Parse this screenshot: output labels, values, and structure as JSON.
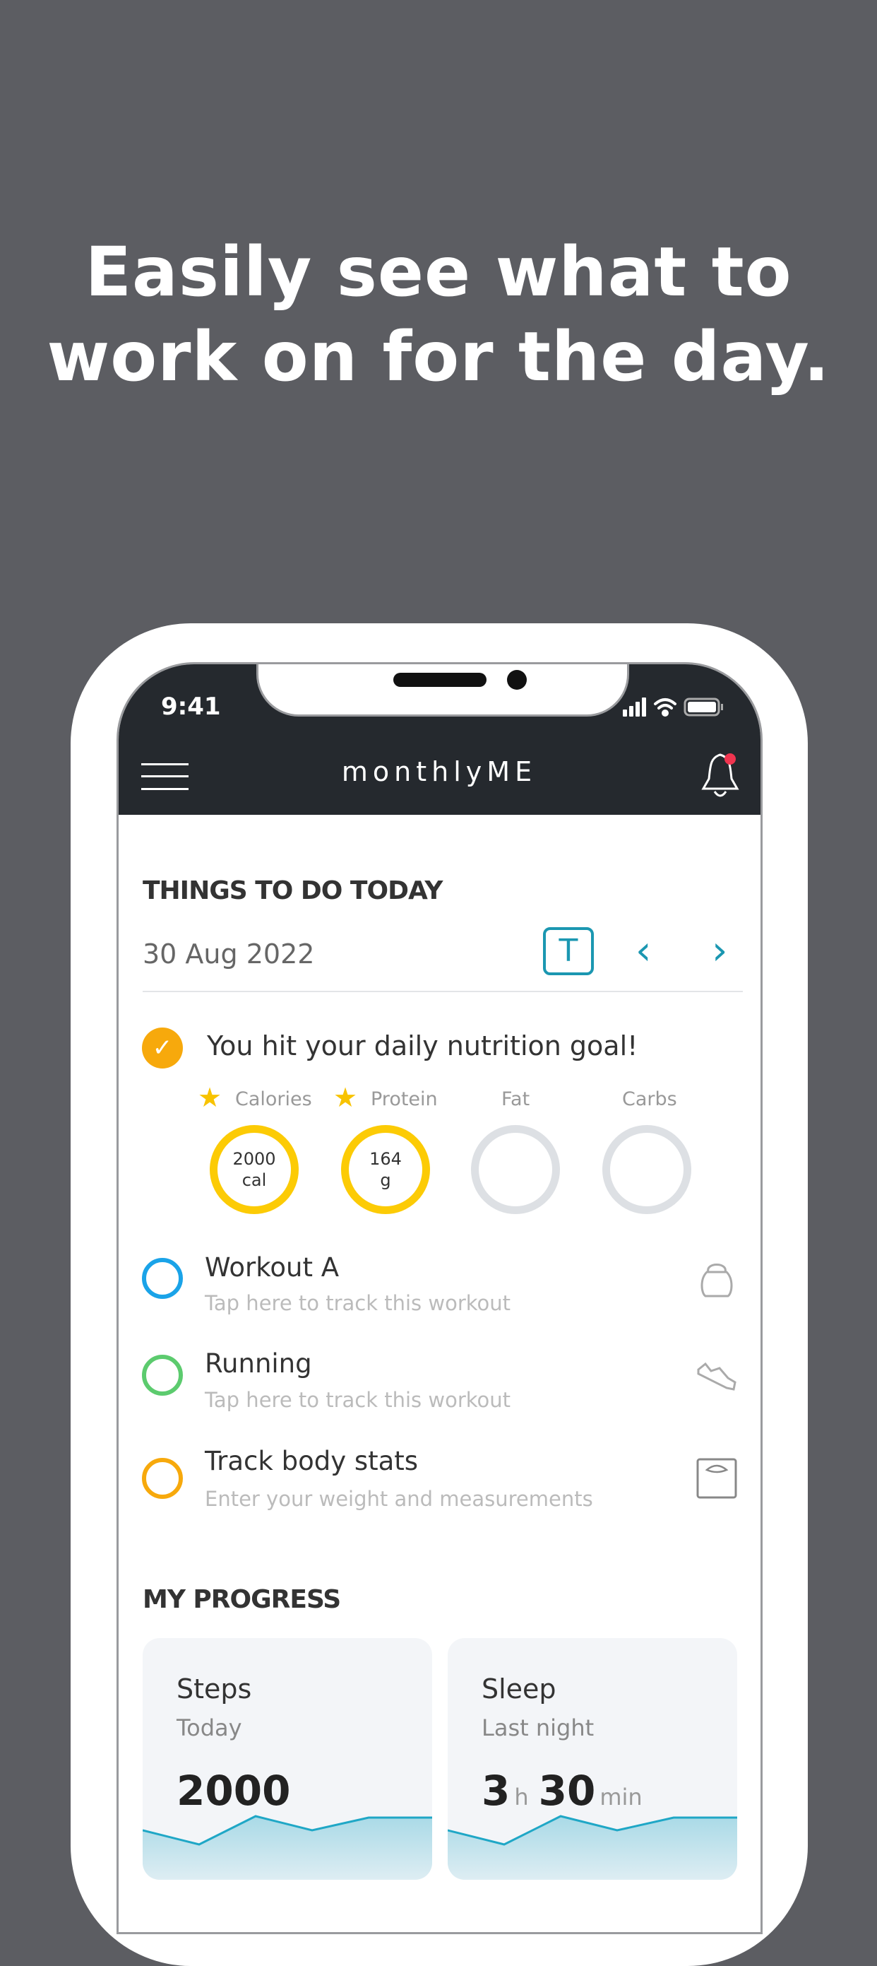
{
  "headline": {
    "line1": "Easily see what to",
    "line2": "work on for the day."
  },
  "status_bar": {
    "time": "9:41",
    "icons": [
      "signal-icon",
      "wifi-icon",
      "battery-icon"
    ]
  },
  "app_header": {
    "logo": "monthlyME",
    "menu_icon": "hamburger-icon",
    "notification_icon": "bell-icon",
    "notification_dot_color": "#f0344f"
  },
  "todo": {
    "section_title": "THINGS TO DO TODAY",
    "date": "30 Aug 2022",
    "today_button": "T",
    "prev": "‹",
    "next": "›",
    "accent": "#1b97b1",
    "nutrition": {
      "message": "You hit your daily nutrition goal!",
      "completed": true,
      "macros": [
        {
          "label": "Calories",
          "starred": true,
          "value": "2000",
          "unit": "cal"
        },
        {
          "label": "Protein",
          "starred": true,
          "value": "164",
          "unit": "g"
        },
        {
          "label": "Fat",
          "starred": false
        },
        {
          "label": "Carbs",
          "starred": false
        }
      ]
    },
    "tasks": [
      {
        "title": "Workout A",
        "subtitle": "Tap here to track this workout",
        "color": "#1aa3e8",
        "icon": "kettlebell-icon"
      },
      {
        "title": "Running",
        "subtitle": "Tap here to track this workout",
        "color": "#5ccb6e",
        "icon": "sneaker-icon"
      },
      {
        "title": "Track body stats",
        "subtitle": "Enter your weight and measurements",
        "color": "#f7a90c",
        "icon": "scale-icon"
      }
    ]
  },
  "progress": {
    "section_title": "MY PROGRESS",
    "cards": [
      {
        "title": "Steps",
        "subtitle": "Today",
        "value": "2000"
      },
      {
        "title": "Sleep",
        "subtitle": "Last night",
        "hours": "3",
        "hours_unit": "h",
        "minutes": "30",
        "minutes_unit": "min"
      }
    ],
    "sparkline_color": "#1fa7c6"
  }
}
